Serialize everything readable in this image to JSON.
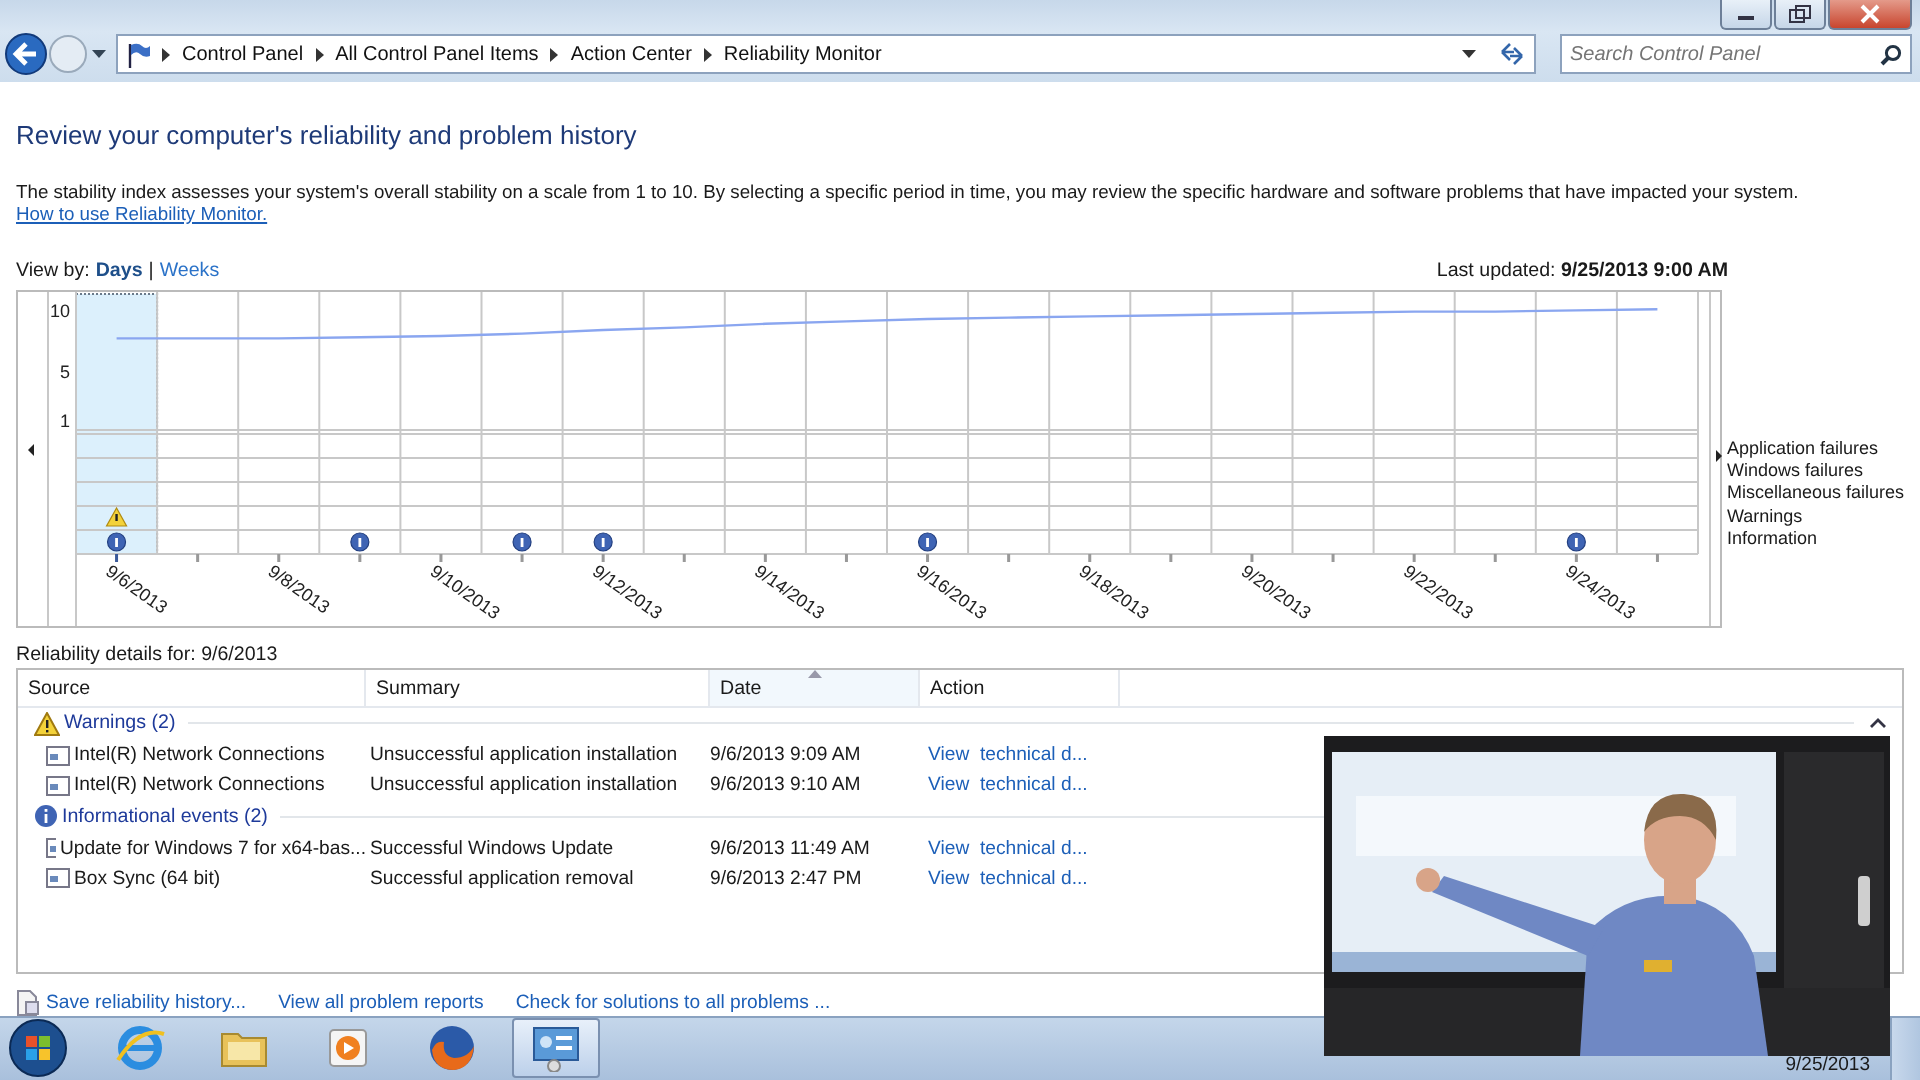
{
  "address_bar": {
    "breadcrumb": [
      "Control Panel",
      "All Control Panel Items",
      "Action Center",
      "Reliability Monitor"
    ],
    "search": {
      "placeholder": "Search Control Panel"
    }
  },
  "heading": "Review your computer's reliability and problem history",
  "description": {
    "text": "The stability index assesses your system's overall stability on a scale from 1 to 10. By selecting a specific period in time, you may review the specific hardware and software problems that have impacted your system.",
    "link": "How to use Reliability Monitor."
  },
  "view_by": {
    "label": "View by:",
    "separator": "|",
    "options": [
      {
        "label": "Days",
        "selected": true
      },
      {
        "label": "Weeks",
        "selected": false
      }
    ]
  },
  "last_updated": {
    "label": "Last updated:",
    "value": "9/25/2013 9:00 AM"
  },
  "chart": {
    "chart_data": {
      "type": "line",
      "ylim": [
        -15.9,
        11.4
      ],
      "yticks": [
        1,
        5,
        10
      ],
      "grid": true,
      "categories": [
        "9/6/2013",
        null,
        "9/8/2013",
        null,
        "9/10/2013",
        null,
        "9/12/2013",
        null,
        "9/14/2013",
        null,
        "9/16/2013",
        null,
        "9/18/2013",
        null,
        "9/20/2013",
        null,
        "9/22/2013",
        null,
        "9/24/2013",
        null
      ],
      "values": [
        7.6,
        7.6,
        7.6,
        7.7,
        7.8,
        8.0,
        8.3,
        8.5,
        8.8,
        9.0,
        9.2,
        9.3,
        9.4,
        9.5,
        9.6,
        9.7,
        9.8,
        9.8,
        9.9,
        10.0
      ]
    },
    "days": [
      {
        "selected": true,
        "events": [
          {
            "kind": "warning"
          },
          {
            "kind": "information"
          }
        ]
      },
      {
        "selected": false
      },
      {
        "selected": false
      },
      {
        "selected": false,
        "events": [
          {
            "kind": "information"
          }
        ]
      },
      {
        "selected": false
      },
      {
        "selected": false,
        "events": [
          {
            "kind": "information"
          }
        ]
      },
      {
        "selected": false,
        "events": [
          {
            "kind": "information"
          }
        ]
      },
      {
        "selected": false
      },
      {
        "selected": false
      },
      {
        "selected": false
      },
      {
        "selected": false,
        "events": [
          {
            "kind": "information"
          }
        ]
      },
      {
        "selected": false
      },
      {
        "selected": false
      },
      {
        "selected": false
      },
      {
        "selected": false
      },
      {
        "selected": false
      },
      {
        "selected": false
      },
      {
        "selected": false
      },
      {
        "selected": false,
        "events": [
          {
            "kind": "information"
          }
        ]
      },
      {
        "selected": false
      }
    ],
    "legend": [
      "Application failures",
      "Windows failures",
      "Miscellaneous failures",
      "Warnings",
      "Information"
    ]
  },
  "details": {
    "title": "Reliability details for: 9/6/2013",
    "columns": [
      {
        "label": "Source",
        "sorted": false
      },
      {
        "label": "Summary",
        "sorted": false
      },
      {
        "label": "Date",
        "sorted": true
      },
      {
        "label": "Action",
        "sorted": false
      }
    ],
    "groups": [
      {
        "kind": "warning",
        "title": "Warnings (2)",
        "focused": true,
        "rows": [
          {
            "source": "Intel(R) Network Connections",
            "summary": "Unsuccessful application installation",
            "date": "9/6/2013 9:09 AM",
            "action": "View  technical d..."
          },
          {
            "source": "Intel(R) Network Connections",
            "summary": "Unsuccessful application installation",
            "date": "9/6/2013 9:10 AM",
            "action": "View  technical d..."
          }
        ]
      },
      {
        "kind": "info",
        "title": "Informational events (2)",
        "focused": false,
        "rows": [
          {
            "source": "Update for Windows 7 for x64-bas...",
            "summary": "Successful Windows Update",
            "date": "9/6/2013 11:49 AM",
            "action": "View  technical d..."
          },
          {
            "source": "Box Sync (64 bit)",
            "summary": "Successful application removal",
            "date": "9/6/2013 2:47 PM",
            "action": "View  technical d..."
          }
        ]
      }
    ]
  },
  "footer_links": [
    {
      "label": "Save reliability history...",
      "kind": "save"
    },
    {
      "label": "View all problem reports",
      "kind": "plain"
    },
    {
      "label": "Check for solutions to all problems ...",
      "kind": "plain"
    }
  ],
  "taskbar": {
    "items": [
      {
        "kind": "ie",
        "selected": false
      },
      {
        "kind": "explorer",
        "selected": false
      },
      {
        "kind": "media",
        "selected": false
      },
      {
        "kind": "firefox",
        "selected": false
      },
      {
        "kind": "control",
        "selected": true
      }
    ],
    "clock": "9/25/2013"
  }
}
